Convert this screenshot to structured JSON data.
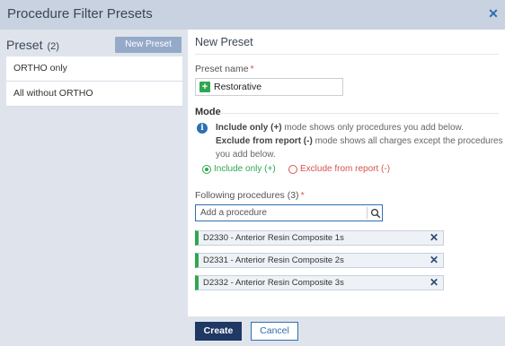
{
  "dialog": {
    "title": "Procedure Filter Presets"
  },
  "left": {
    "header": "Preset",
    "count": "(2)",
    "new_button": "New Preset",
    "presets": [
      {
        "label": "ORTHO only"
      },
      {
        "label": "All without ORTHO"
      }
    ]
  },
  "form": {
    "heading": "New Preset",
    "name_label": "Preset name",
    "required_mark": "*",
    "name_value": "Restorative",
    "mode_title": "Mode",
    "info_include_bold": "Include only (+)",
    "info_include_rest": " mode shows only procedures you add below.",
    "info_exclude_bold": "Exclude from report (-)",
    "info_exclude_rest": " mode shows all charges except the procedures",
    "info_exclude_rest2": "you add below.",
    "mode_include": "Include only (+)",
    "mode_exclude": "Exclude from report (-)",
    "selected_mode": "Include only (+)",
    "procedures_label": "Following procedures (3)",
    "search_placeholder": "Add a procedure",
    "procedures": [
      {
        "label": "D2330 - Anterior Resin Composite 1s"
      },
      {
        "label": "D2331 - Anterior Resin Composite 2s"
      },
      {
        "label": "D2332 - Anterior Resin Composite 3s"
      }
    ]
  },
  "footer": {
    "create": "Create",
    "cancel": "Cancel"
  },
  "colors": {
    "accent": "#2e6fb0",
    "primary_button": "#1f3864",
    "include_green": "#2fa84f",
    "exclude_red": "#d9534f"
  }
}
